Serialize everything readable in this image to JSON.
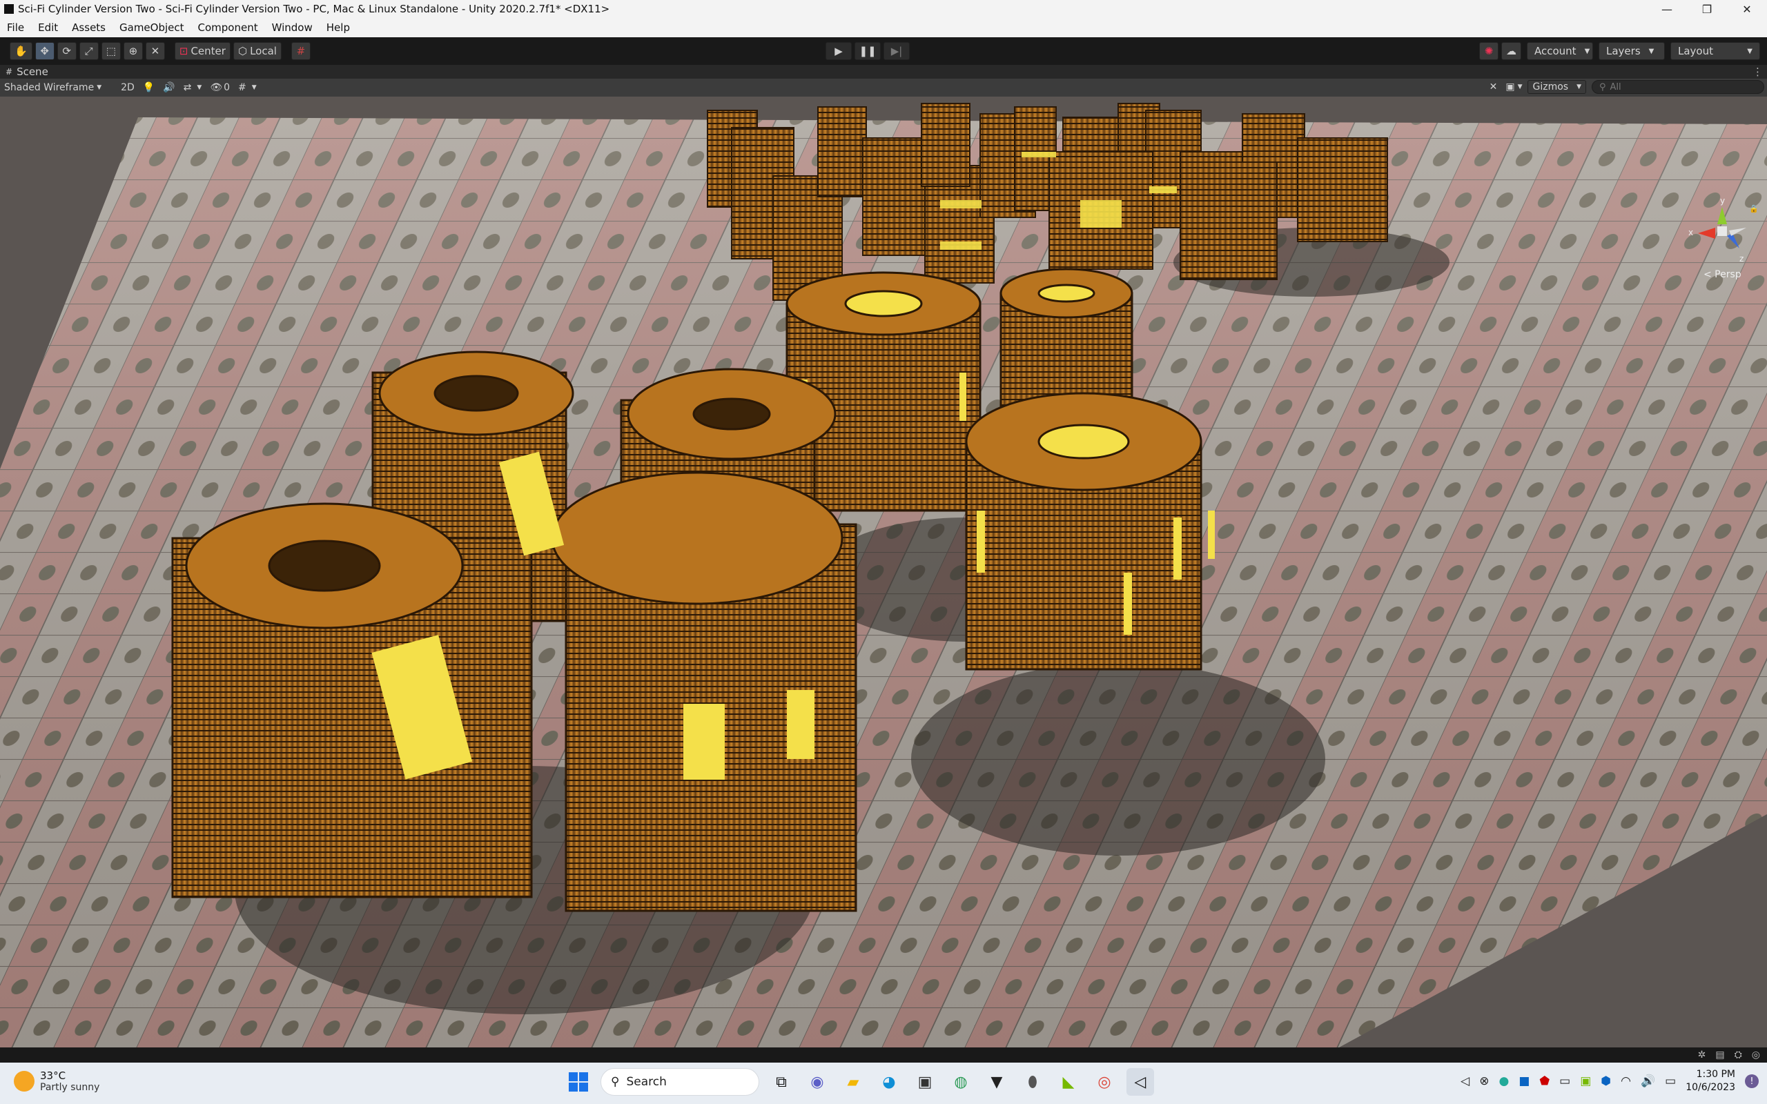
{
  "window": {
    "title": "Sci-Fi Cylinder Version Two - Sci-Fi Cylinder Version Two - PC, Mac & Linux Standalone - Unity 2020.2.7f1* <DX11>",
    "minimize": "—",
    "maximize": "❐",
    "close": "✕"
  },
  "menu": [
    "File",
    "Edit",
    "Assets",
    "GameObject",
    "Component",
    "Window",
    "Help"
  ],
  "toolbar": {
    "pivot": "Center",
    "space": "Local",
    "account": "Account",
    "layers": "Layers",
    "layout": "Layout"
  },
  "scene": {
    "tab_label": "Scene",
    "shading_mode": "Shaded Wireframe",
    "mode_2d": "2D",
    "hidden_count": "0",
    "gizmos": "Gizmos",
    "search_placeholder": "All",
    "persp_label": "< Persp",
    "axis_x": "x",
    "axis_y": "y",
    "axis_z": "z"
  },
  "taskbar": {
    "temperature": "33°C",
    "weather": "Partly sunny",
    "search": "Search",
    "time": "1:30 PM",
    "date": "10/6/2023"
  },
  "colors": {
    "asset_orange": "#b8741f",
    "glow_yellow": "#f4e04a",
    "ground_pink": "#b48a84",
    "ground_grey": "#a8a39b"
  }
}
